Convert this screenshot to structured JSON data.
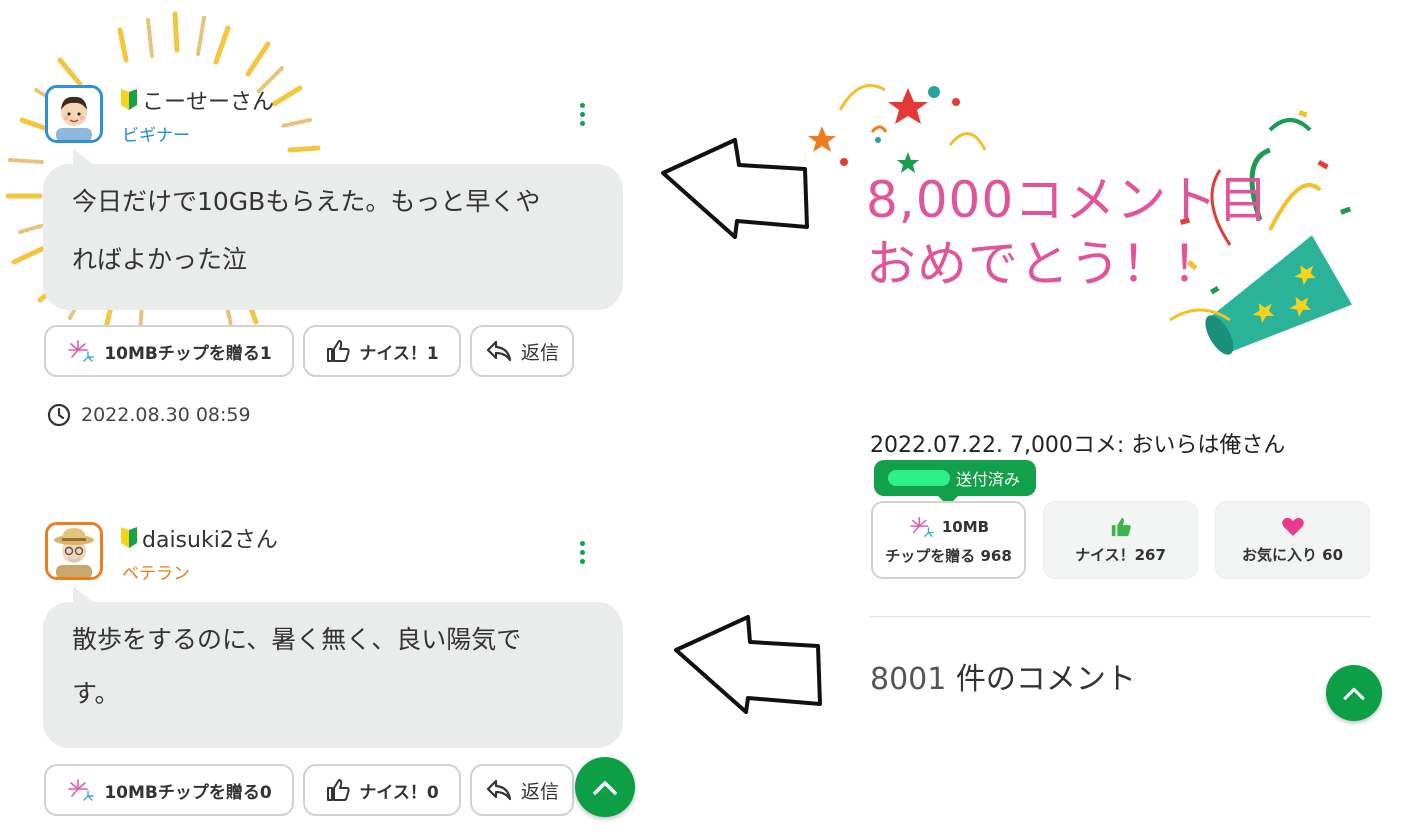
{
  "comments": [
    {
      "username": "こーせーさん",
      "rank": "ビギナー",
      "body_line1": "今日だけで10GBもらえた。もっと早くや",
      "body_line2": "ればよかった泣",
      "tip_label": "10MBチップを贈る1",
      "nice_label": "ナイス！1",
      "reply_label": "返信",
      "timestamp": "2022.08.30 08:59"
    },
    {
      "username": "daisuki2さん",
      "rank": "ベテラン",
      "body_line1": "散歩をするのに、暑く無く、良い陽気で",
      "body_line2": "す。",
      "tip_label": "10MBチップを贈る0",
      "nice_label": "ナイス！0",
      "reply_label": "返信"
    }
  ],
  "celebration": {
    "line1": "8,000コメント目",
    "line2": "おめでとう！！"
  },
  "history": {
    "line": "2022.07.22. 7,000コメ: おいらは俺さん",
    "sent_badge": "送付済み",
    "cards": {
      "tip_top": "10MB",
      "tip_bottom": "チップを贈る 968",
      "nice": "ナイス！267",
      "favorite": "お気に入り 60"
    },
    "comment_count_number": "8001",
    "comment_count_suffix": "件のコメント"
  },
  "colors": {
    "accent_green": "#13a04a",
    "beginner_blue": "#1b8fd6",
    "veteran_orange": "#ea7b16",
    "celebration_pink": "#e2549a",
    "heart_pink": "#e93a8e"
  },
  "icons": [
    "beginner-mark-icon",
    "kebab-menu-icon",
    "fireworks-icon",
    "thumbs-up-icon",
    "reply-icon",
    "clock-icon",
    "chevron-up-icon",
    "heart-icon",
    "party-popper-icon",
    "arrow-left-icon"
  ]
}
